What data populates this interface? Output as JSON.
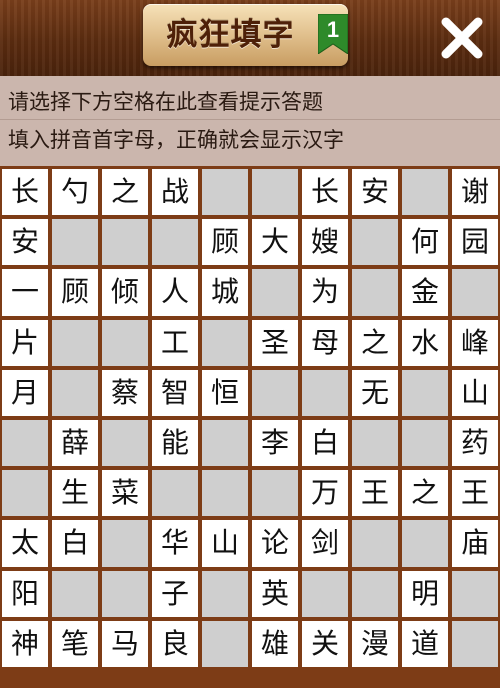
{
  "header": {
    "title": "疯狂填字",
    "level": "1",
    "close_icon": "close-x-icon"
  },
  "hint": {
    "line1": "请选择下方空格在此查看提示答题",
    "line2": "填入拼音首字母，正确就会显示汉字"
  },
  "colors": {
    "board_frame": "#7d3c16",
    "cell_white": "#ffffff",
    "cell_grey": "#cfcfcf",
    "hint_bg": "#cbb6ad",
    "badge_green": "#2e8a2a"
  },
  "grid": [
    [
      "长",
      "勺",
      "之",
      "战",
      "#",
      "#",
      "长",
      "安",
      "#",
      "谢"
    ],
    [
      "安",
      "#",
      "#",
      "#",
      "顾",
      "大",
      "嫂",
      "#",
      "何",
      "园"
    ],
    [
      "一",
      "顾",
      "倾",
      "人",
      "城",
      "#",
      "为",
      "#",
      "金",
      "#"
    ],
    [
      "片",
      "#",
      "#",
      "工",
      "#",
      "圣",
      "母",
      "之",
      "水",
      "峰"
    ],
    [
      "月",
      "#",
      "蔡",
      "智",
      "恒",
      "#",
      "#",
      "无",
      "#",
      "山"
    ],
    [
      "#",
      "薛",
      "#",
      "能",
      "#",
      "李",
      "白",
      "#",
      "#",
      "药"
    ],
    [
      "#",
      "生",
      "菜",
      "#",
      "#",
      "#",
      "万",
      "王",
      "之",
      "王"
    ],
    [
      "太",
      "白",
      "#",
      "华",
      "山",
      "论",
      "剑",
      "#",
      "#",
      "庙"
    ],
    [
      "阳",
      "#",
      "#",
      "子",
      "#",
      "英",
      "#",
      "#",
      "明",
      "#"
    ],
    [
      "神",
      "笔",
      "马",
      "良",
      "#",
      "雄",
      "关",
      "漫",
      "道",
      "#"
    ]
  ]
}
